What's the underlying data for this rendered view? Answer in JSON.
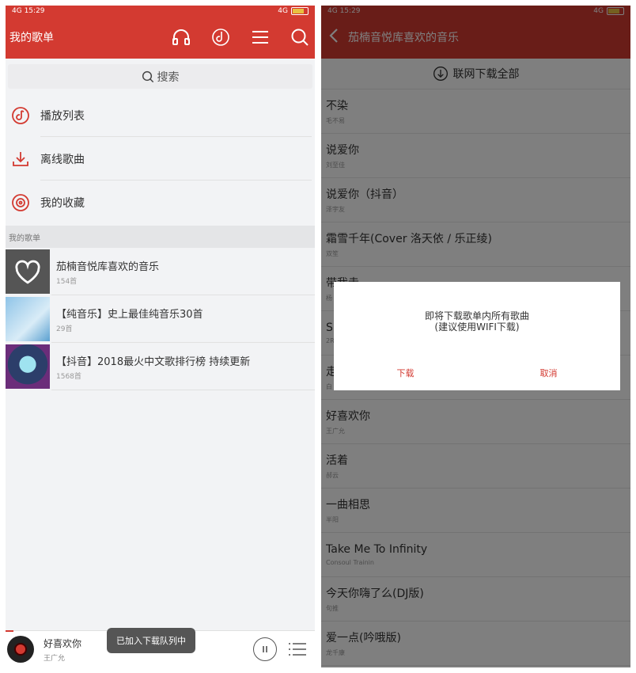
{
  "left": {
    "status": {
      "time": "15:29",
      "net": "4G",
      "tag": "4G"
    },
    "header": {
      "title": "我的歌单"
    },
    "search": {
      "placeholder": "搜索"
    },
    "menu": [
      {
        "label": "播放列表",
        "icon": "playlist-icon"
      },
      {
        "label": "离线歌曲",
        "icon": "download-icon"
      },
      {
        "label": "我的收藏",
        "icon": "favorite-disc-icon"
      }
    ],
    "section_title": "我的歌单",
    "playlists": [
      {
        "name": "茄楠音悦库喜欢的音乐",
        "count": "154首"
      },
      {
        "name": "【纯音乐】史上最佳纯音乐30首",
        "count": "29首"
      },
      {
        "name": "【抖音】2018最火中文歌排行榜 持续更新",
        "count": "1568首"
      }
    ],
    "player": {
      "song": "好喜欢你",
      "artist": "王广允"
    },
    "toast": "已加入下载队列中"
  },
  "right": {
    "status": {
      "time": "15:29",
      "net": "4G",
      "tag": "4G"
    },
    "header": {
      "title": "茄楠音悦库喜欢的音乐"
    },
    "download_all": "联网下载全部",
    "songs": [
      {
        "title": "不染",
        "artist": "毛不易"
      },
      {
        "title": "说爱你",
        "artist": "刘至佳"
      },
      {
        "title": "说爱你（抖音）",
        "artist": "泽宇友"
      },
      {
        "title": "霜雪千年(Cover 洛天依 / 乐正绫)",
        "artist": "双笙"
      },
      {
        "title": "带我走",
        "artist": "杨"
      },
      {
        "title": "Sp",
        "artist": "2R"
      },
      {
        "title": "走",
        "artist": "白"
      },
      {
        "title": "好喜欢你",
        "artist": "王广允"
      },
      {
        "title": "活着",
        "artist": "郝云"
      },
      {
        "title": "一曲相思",
        "artist": "半阳"
      },
      {
        "title": "Take Me To Infinity",
        "artist": "Consoul Trainin"
      },
      {
        "title": "今天你嗨了么(DJ版)",
        "artist": "句推"
      },
      {
        "title": "爱一点(吟哦版)",
        "artist": "龙千康"
      }
    ],
    "dialog": {
      "message1": "即将下载歌单内所有歌曲",
      "message2": "(建议使用WIFI下载)",
      "confirm": "下载",
      "cancel": "取消"
    }
  },
  "colors": {
    "accent": "#d33a31"
  }
}
